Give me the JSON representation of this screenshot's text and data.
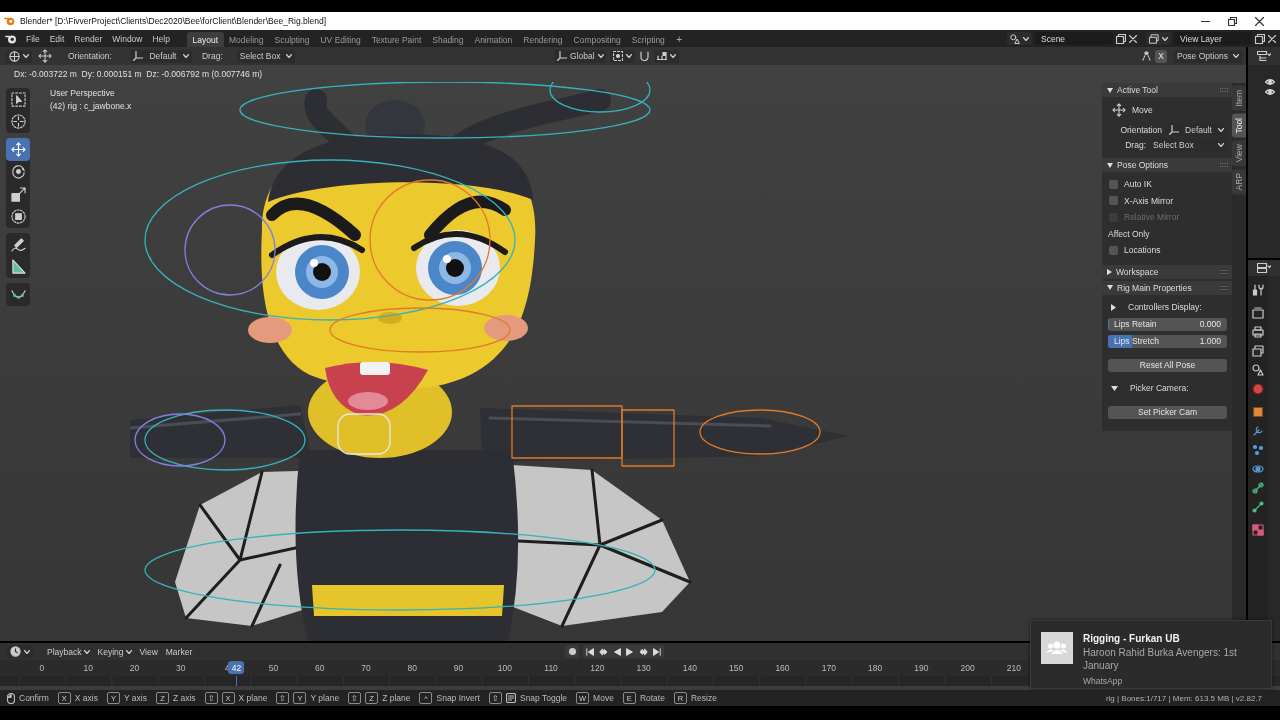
{
  "title_bar": {
    "title": "Blender* [D:\\FivverProject\\Clients\\Dec2020\\Bee\\forClient\\Blender\\Bee_Rig.blend]"
  },
  "top_bar": {
    "menus": [
      "File",
      "Edit",
      "Render",
      "Window",
      "Help"
    ],
    "workspaces": [
      {
        "label": "Layout",
        "selected": true
      },
      {
        "label": "Modeling",
        "selected": false
      },
      {
        "label": "Sculpting",
        "selected": false
      },
      {
        "label": "UV Editing",
        "selected": false
      },
      {
        "label": "Texture Paint",
        "selected": false
      },
      {
        "label": "Shading",
        "selected": false
      },
      {
        "label": "Animation",
        "selected": false
      },
      {
        "label": "Rendering",
        "selected": false
      },
      {
        "label": "Compositing",
        "selected": false
      },
      {
        "label": "Scripting",
        "selected": false
      }
    ],
    "add_workspace": "+",
    "scene": "Scene",
    "view_layer": "View Layer"
  },
  "tool_header": {
    "orientation_label": "Orientation:",
    "orientation": "Default",
    "drag_label": "Drag:",
    "drag": "Select Box",
    "transform_orientation": "Global",
    "mirror_x": "X",
    "pose_options": "Pose Options"
  },
  "viewport": {
    "transform_info": "Dx: -0.003722 m  Dy: 0.000151 m  Dz: -0.006792 m (0.007746 m)",
    "view_name": "User Perspective",
    "active_bone": "(42) rig : c_jawbone.x",
    "toolbar": [
      {
        "tools": [
          {
            "kind": "select_box",
            "selected": false
          },
          {
            "kind": "cursor",
            "selected": false
          }
        ]
      },
      {
        "tools": [
          {
            "kind": "move",
            "selected": true
          },
          {
            "kind": "rotate",
            "selected": false
          },
          {
            "kind": "scale",
            "selected": false
          },
          {
            "kind": "transform",
            "selected": false
          }
        ]
      },
      {
        "tools": [
          {
            "kind": "annotate",
            "selected": false
          },
          {
            "kind": "measure",
            "selected": false
          }
        ]
      },
      {
        "tools": [
          {
            "kind": "bone_curve",
            "selected": false
          }
        ]
      }
    ]
  },
  "sidebar": {
    "tabs": [
      {
        "label": "Item",
        "selected": false
      },
      {
        "label": "Tool",
        "selected": true
      },
      {
        "label": "View",
        "selected": false
      },
      {
        "label": "ARP",
        "selected": false
      }
    ],
    "panels": [
      {
        "title": "Active Tool",
        "expanded": true,
        "rows": [
          {
            "kind": "tool",
            "label": "Move"
          },
          {
            "kind": "icon_dropdown",
            "label": "Orientation",
            "value": "Default"
          },
          {
            "kind": "dropdown",
            "label": "Drag:",
            "value": "Select Box"
          }
        ]
      },
      {
        "title": "Pose Options",
        "expanded": true,
        "rows": [
          {
            "kind": "checkbox",
            "label": "Auto IK",
            "checked": false,
            "disabled": false
          },
          {
            "kind": "checkbox",
            "label": "X-Axis Mirror",
            "checked": false,
            "disabled": false
          },
          {
            "kind": "checkbox",
            "label": "Relative Mirror",
            "checked": false,
            "disabled": true
          },
          {
            "kind": "label",
            "label": "Affect Only"
          },
          {
            "kind": "checkbox",
            "label": "Locations",
            "checked": false,
            "disabled": false
          }
        ]
      },
      {
        "title": "Workspace",
        "expanded": false
      },
      {
        "title": "Rig Main Properties",
        "expanded": true,
        "rows": [
          {
            "kind": "subpanel",
            "label": "Controllers Display:",
            "expanded": false
          },
          {
            "kind": "slider",
            "label": "Lips Retain",
            "value": "0.000",
            "level": 0
          },
          {
            "kind": "slider",
            "label": "Lips Stretch",
            "value": "1.000",
            "level": 0.2
          },
          {
            "kind": "button",
            "label": "Reset All Pose"
          },
          {
            "kind": "subpanel",
            "label": "Picker Camera:",
            "expanded": true
          },
          {
            "kind": "button",
            "label": "Set Picker Cam"
          }
        ]
      }
    ]
  },
  "timeline": {
    "menus": [
      {
        "label": "Playback",
        "dropdown": true
      },
      {
        "label": "Keying",
        "dropdown": true
      },
      {
        "label": "View",
        "dropdown": false
      },
      {
        "label": "Marker",
        "dropdown": false
      }
    ],
    "ticks": [
      "0",
      "10",
      "20",
      "30",
      "4",
      "50",
      "60",
      "70",
      "80",
      "90",
      "100",
      "110",
      "120",
      "130",
      "140",
      "150",
      "160",
      "170",
      "180",
      "190",
      "200",
      "210"
    ],
    "current_frame": "42"
  },
  "status_bar": {
    "hints": [
      {
        "kind": "mouse",
        "label": "Confirm"
      },
      {
        "kind": "keys",
        "keys": [
          "X"
        ],
        "label": "X axis"
      },
      {
        "kind": "keys",
        "keys": [
          "Y"
        ],
        "label": "Y axis"
      },
      {
        "kind": "keys",
        "keys": [
          "Z"
        ],
        "label": "Z axis"
      },
      {
        "kind": "keys",
        "keys": [
          "⇧",
          "X"
        ],
        "label": "X plane"
      },
      {
        "kind": "keys",
        "keys": [
          "⇧",
          "Y"
        ],
        "label": "Y plane"
      },
      {
        "kind": "keys",
        "keys": [
          "⇧",
          "Z"
        ],
        "label": "Z plane"
      },
      {
        "kind": "keys",
        "keys": [
          "^"
        ],
        "label": "Snap Invert"
      },
      {
        "kind": "icon_keys",
        "keys": [
          "⇧"
        ],
        "label": "Snap Toggle"
      },
      {
        "kind": "keys",
        "keys": [
          "W"
        ],
        "label": "Move"
      },
      {
        "kind": "keys",
        "keys": [
          "E"
        ],
        "label": "Rotate"
      },
      {
        "kind": "keys",
        "keys": [
          "R"
        ],
        "label": "Resize"
      }
    ],
    "stats": "rig | Bones:1/717 | Mem: 613.5 MB | v2.82.7"
  },
  "notification": {
    "title": "Rigging - Furkan UB",
    "message": "Haroon Rahid Burka Avengers: 1st January",
    "app": "WhatsApp"
  }
}
